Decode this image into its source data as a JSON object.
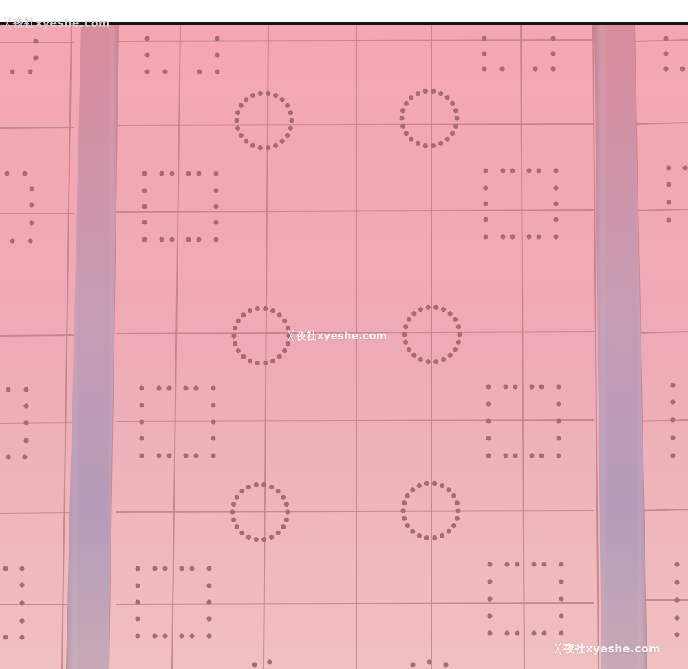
{
  "scene": {
    "type": "illustration",
    "subject": "pink tiled wall with dotted ornaments",
    "colors": {
      "bg_top": "#f5a6b3",
      "bg_mid": "#f0a9b6",
      "bg_bottom": "#f1c0c0",
      "grid_line": "#bf8086",
      "dot": "#a86c6e",
      "pillar_top": "#d98c9c",
      "pillar_mid": "#b89ab5",
      "pillar_bottom": "#c8a7b4"
    }
  },
  "watermarks": {
    "top": {
      "mark": "╳",
      "text": "夜社xyeshe.com"
    },
    "center": {
      "mark": "╳",
      "text": "夜社xyeshe.com"
    },
    "bottom": {
      "mark": "╳",
      "text": "夜社xyeshe.com"
    }
  }
}
